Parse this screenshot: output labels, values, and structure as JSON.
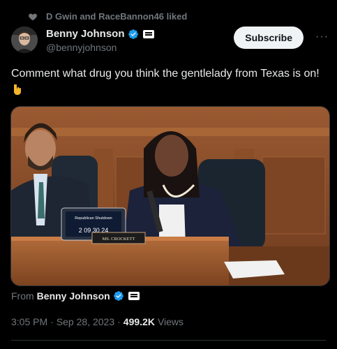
{
  "social_context": {
    "text": "D Gwin and RaceBannon46 liked"
  },
  "author": {
    "name": "Benny Johnson",
    "handle": "@bennyjohnson"
  },
  "actions": {
    "subscribe_label": "Subscribe",
    "more_label": "···"
  },
  "tweet": {
    "text": "Comment what drug you think the gentlelady from Texas is on!"
  },
  "media": {
    "laptop_sticker": "Republican Shutdown",
    "laptop_timer": "2  09  30  24",
    "nameplate": "MS. CROCKETT"
  },
  "source": {
    "from_label": "From",
    "name": "Benny Johnson"
  },
  "meta": {
    "time": "3:05 PM",
    "separator1": "·",
    "date": "Sep 28, 2023",
    "separator2": "·",
    "views_count": "499.2K",
    "views_label": "Views"
  },
  "colors": {
    "verified": "#1d9bf0",
    "background": "#000000",
    "muted": "#71767b"
  }
}
